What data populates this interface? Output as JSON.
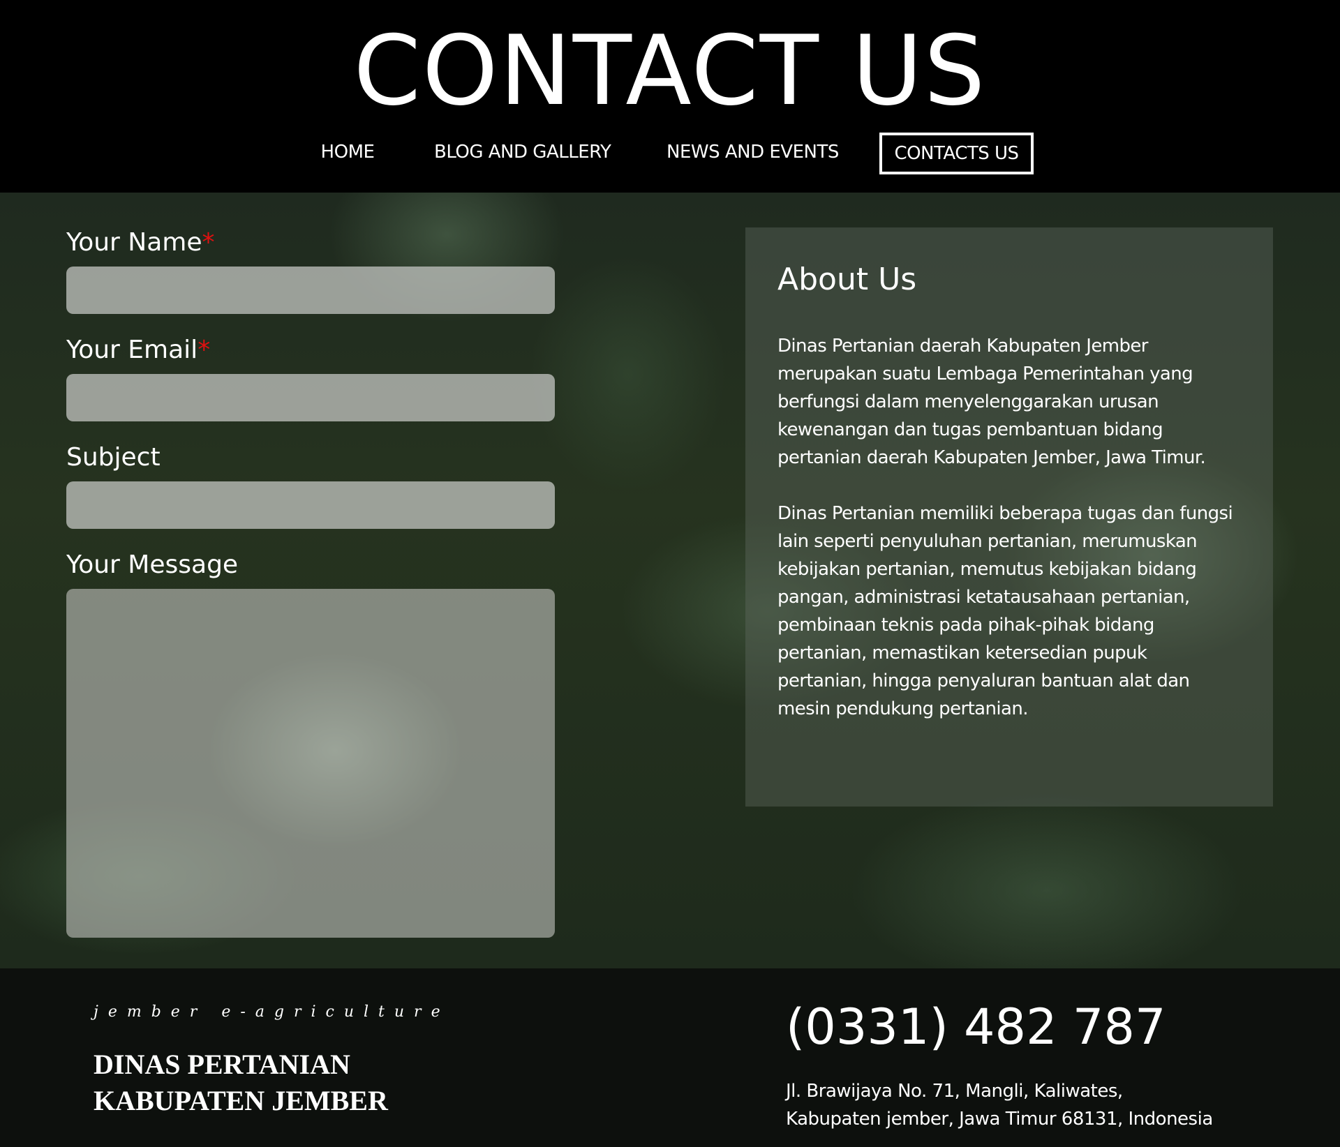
{
  "header": {
    "title": "CONTACT US"
  },
  "nav": {
    "items": [
      {
        "label": "HOME",
        "active": false
      },
      {
        "label": "BLOG AND GALLERY",
        "active": false
      },
      {
        "label": "NEWS AND EVENTS",
        "active": false
      },
      {
        "label": "CONTACTS US",
        "active": true
      }
    ]
  },
  "form": {
    "name_label": "Your Name",
    "email_label": "Your Email",
    "subject_label": "Subject",
    "message_label": "Your Message",
    "required_mark": "*",
    "name_value": "",
    "email_value": "",
    "subject_value": "",
    "message_value": ""
  },
  "about": {
    "title": "About Us",
    "paragraphs": [
      "Dinas Pertanian daerah Kabupaten Jember merupakan suatu Lembaga Pemerintahan yang berfungsi dalam menyelenggarakan urusan kewenangan dan tugas pembantuan bidang pertanian daerah Kabupaten Jember, Jawa Timur.",
      "Dinas Pertanian memiliki beberapa tugas dan fungsi lain seperti penyuluhan pertanian, merumuskan kebijakan pertanian, memutus kebijakan bidang pangan, administrasi ketatausahaan pertanian, pembinaan teknis pada pihak-pihak bidang pertanian, memastikan ketersedian pupuk pertanian, hingga penyaluran bantuan alat dan mesin pendukung pertanian."
    ]
  },
  "footer": {
    "tagline": "jember e-agriculture",
    "org_line1": "DINAS PERTANIAN",
    "org_line2": "KABUPATEN JEMBER",
    "phone": "(0331) 482 787",
    "address_line1": "Jl. Brawijaya No. 71, Mangli, Kaliwates,",
    "address_line2": "Kabupaten jember, Jawa Timur 68131, Indonesia"
  },
  "colors": {
    "header_bg": "#000000",
    "required": "#e01010",
    "footer_bg": "#0d100d",
    "text": "#ffffff"
  }
}
